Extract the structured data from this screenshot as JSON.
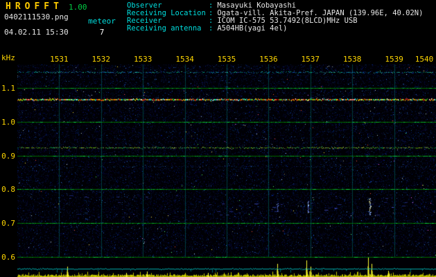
{
  "app": {
    "title": "HROFFT",
    "version": "1.00",
    "filename": "0402111530.png",
    "mode_label": "meteor",
    "meteor_count": "7",
    "datetime": "04.02.11 15:30"
  },
  "info": {
    "separator": ":",
    "rows": [
      {
        "label": "Observer",
        "value": "Masayuki Kobayashi"
      },
      {
        "label": "Receiving Location",
        "value": "Ogata-vill. Akita-Pref. JAPAN (139.96E, 40.02N)"
      },
      {
        "label": "Receiver",
        "value": "ICOM IC-575 53.7492(8LCD)MHz USB"
      },
      {
        "label": "Receiving antenna",
        "value": "A504HB(yagi 4el)"
      }
    ]
  },
  "colors": {
    "axis_yellow": "#ffd700",
    "label_cyan": "#00dddd",
    "text_white": "#e6e6e6",
    "version_green": "#00cc44",
    "title_gold": "#ffcc00"
  },
  "chart_data": {
    "type": "heatmap",
    "title": "",
    "xlabel": "",
    "ylabel": "kHz",
    "y_ticks": [
      1.1,
      1.0,
      0.9,
      0.8,
      0.7,
      0.6
    ],
    "y_tick_labels": [
      "1.1",
      "1.0",
      "0.9",
      "0.8",
      "0.7",
      "0.6"
    ],
    "x_tick_labels": [
      "1531",
      "1532",
      "1533",
      "1534",
      "1535",
      "1536",
      "1537",
      "1538",
      "1539",
      "1540"
    ],
    "duration_min": 10,
    "freq_range_khz": [
      0.6,
      1.17
    ],
    "grid": {
      "h_color": "#007700",
      "v_color": "#007070"
    },
    "noise": {
      "background": "#000005",
      "speckle_count": 30000
    },
    "carriers": [
      {
        "freq_khz": 1.148,
        "density": 0.7,
        "thickness": 1,
        "alpha": [
          0.3,
          0.85
        ],
        "palette": [
          "#00e0e0",
          "#00aaff",
          "#55ffcc",
          "#2266ff",
          "#00ff99"
        ]
      },
      {
        "freq_khz": 1.067,
        "density": 0.97,
        "thickness": 2,
        "alpha": [
          0.55,
          1.0
        ],
        "palette": [
          "#ffff00",
          "#ff5500",
          "#33ff33",
          "#ffffff",
          "#ff2200",
          "#00ffff",
          "#ffaa00"
        ]
      },
      {
        "freq_khz": 0.924,
        "density": 0.8,
        "thickness": 1,
        "alpha": [
          0.35,
          0.9
        ],
        "palette": [
          "#aaff00",
          "#44cc22",
          "#ffff44",
          "#00dd66",
          "#88ff88"
        ]
      },
      {
        "freq_khz": 0.868,
        "density": 0.3,
        "thickness": 1,
        "alpha": [
          0.15,
          0.45
        ],
        "palette": [
          "#2244cc",
          "#3366dd",
          "#0077bb"
        ]
      }
    ],
    "echo_band": {
      "t_range": [
        0.8,
        9.3
      ],
      "freq_range": [
        0.715,
        0.785
      ],
      "count": 60,
      "palette": [
        "#3344bb",
        "#4455dd",
        "#223399",
        "#5566ff"
      ]
    },
    "meteor_events": [
      {
        "t_min": 6.21,
        "freq_khz": 0.748,
        "span_khz": 0.025,
        "brightness": 0.25,
        "palette": [
          "#6688ff",
          "#99bbff",
          "#4455ee"
        ]
      },
      {
        "t_min": 6.93,
        "freq_khz": 0.748,
        "span_khz": 0.035,
        "brightness": 0.35,
        "palette": [
          "#77aaff",
          "#bbddff",
          "#5566ff"
        ]
      },
      {
        "t_min": 8.41,
        "freq_khz": 0.75,
        "span_khz": 0.05,
        "brightness": 0.75,
        "palette": [
          "#ffffff",
          "#aaccff",
          "#ffff99",
          "#88aaff"
        ]
      }
    ],
    "amplitude": {
      "baseline_color": "#d8d800",
      "spike_color": "#ffff33",
      "threshold_color": "#00c8c8",
      "spikes": [
        {
          "t_min": 1.19,
          "height": 0.5
        },
        {
          "t_min": 2.6,
          "height": 0.22
        },
        {
          "t_min": 3.1,
          "height": 0.28
        },
        {
          "t_min": 4.55,
          "height": 0.2
        },
        {
          "t_min": 6.21,
          "height": 0.65
        },
        {
          "t_min": 6.9,
          "height": 0.82
        },
        {
          "t_min": 7.0,
          "height": 0.5
        },
        {
          "t_min": 8.38,
          "height": 0.97
        },
        {
          "t_min": 8.46,
          "height": 0.66
        },
        {
          "t_min": 8.85,
          "height": 0.3
        }
      ]
    }
  }
}
